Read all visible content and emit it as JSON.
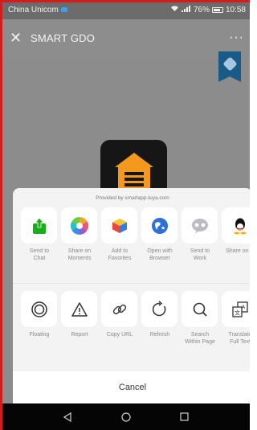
{
  "status_bar": {
    "carrier": "China Unicom",
    "battery": "76%",
    "time": "10:58"
  },
  "app_bar": {
    "title": "SMART GDO",
    "more_label": "···"
  },
  "share_sheet": {
    "provided_by": "Provided by smartapp.tuya.com",
    "row1": [
      {
        "label": "Send to\nChat",
        "icon": "send-to-chat-icon"
      },
      {
        "label": "Share on\nMoments",
        "icon": "moments-icon"
      },
      {
        "label": "Add to\nFavorites",
        "icon": "favorites-icon"
      },
      {
        "label": "Open with\nBrowser",
        "icon": "browser-icon"
      },
      {
        "label": "Send to\nWork",
        "icon": "work-icon"
      },
      {
        "label": "Share on Q",
        "icon": "qq-icon"
      }
    ],
    "row2": [
      {
        "label": "Floating",
        "icon": "floating-icon"
      },
      {
        "label": "Report",
        "icon": "report-icon"
      },
      {
        "label": "Copy URL",
        "icon": "link-icon"
      },
      {
        "label": "Refresh",
        "icon": "refresh-icon"
      },
      {
        "label": "Search\nWithin Page",
        "icon": "search-icon"
      },
      {
        "label": "Translate\nFull Text",
        "icon": "translate-icon"
      }
    ],
    "cancel_label": "Cancel"
  },
  "colors": {
    "sheet_bg": "#f3f3f3",
    "overlay": "#8d8d8d",
    "ribbon": "#1a5a86",
    "logo_orange": "#f39a1e"
  }
}
